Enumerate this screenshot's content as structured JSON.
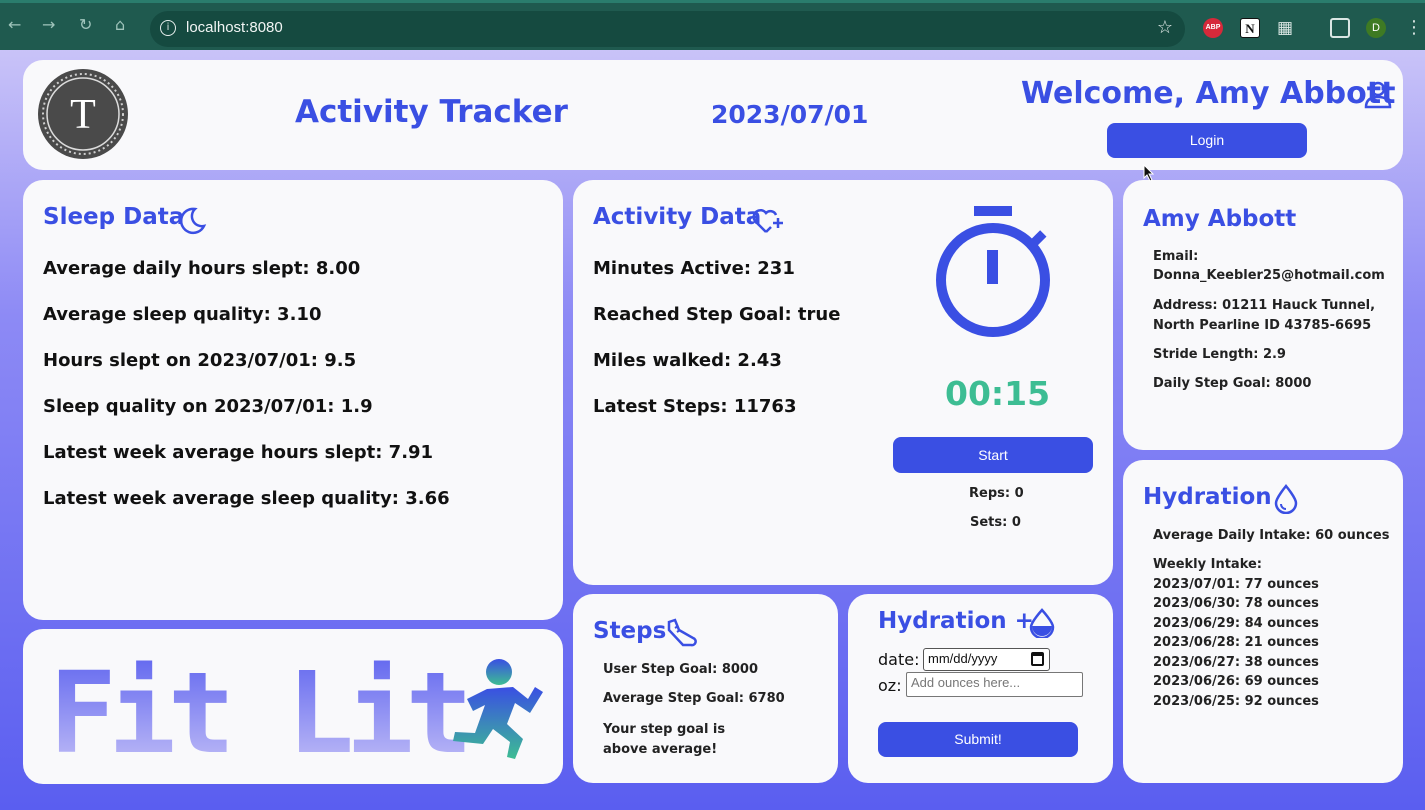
{
  "browser": {
    "url": "localhost:8080",
    "profile_initial": "D",
    "abp_label": "ABP",
    "notion_label": "N"
  },
  "header": {
    "logo_letter": "T",
    "title": "Activity Tracker",
    "date": "2023/07/01",
    "welcome": "Welcome, Amy Abbott",
    "login_label": "Login"
  },
  "sleep": {
    "title": "Sleep Data",
    "rows": [
      "Average daily hours slept: 8.00",
      "Average sleep quality: 3.10",
      "Hours slept on 2023/07/01: 9.5",
      "Sleep quality on 2023/07/01: 1.9",
      "Latest week average hours slept: 7.91",
      "Latest week average sleep quality: 3.66"
    ]
  },
  "activity": {
    "title": "Activity Data",
    "rows": [
      "Minutes Active: 231",
      "Reached Step Goal: true",
      "Miles walked: 2.43",
      "Latest Steps: 11763"
    ],
    "timer": "00:15",
    "start_label": "Start",
    "reps": "Reps: 0",
    "sets": "Sets: 0"
  },
  "profile": {
    "name": "Amy Abbott",
    "email_label": "Email:",
    "email": "Donna_Keebler25@hotmail.com",
    "address": "Address: 01211 Hauck Tunnel, North Pearline ID 43785-6695",
    "stride": "Stride Length: 2.9",
    "step_goal": "Daily Step Goal: 8000"
  },
  "hydration": {
    "title": "Hydration",
    "average": "Average Daily Intake: 60 ounces",
    "weekly_label": "Weekly Intake:",
    "weekly": [
      "2023/07/01: 77 ounces",
      "2023/06/30: 78 ounces",
      "2023/06/29: 84 ounces",
      "2023/06/28: 21 ounces",
      "2023/06/27: 38 ounces",
      "2023/06/26: 69 ounces",
      "2023/06/25: 92 ounces"
    ]
  },
  "fitlit": {
    "wordmark": "Fit Lit"
  },
  "steps": {
    "title": "Steps",
    "user_goal": "User Step Goal: 8000",
    "avg_goal": "Average Step Goal: 6780",
    "message": "Your step goal is above average!"
  },
  "hydration_form": {
    "title": "Hydration +",
    "date_label": "date:",
    "date_placeholder": "mm/dd/yyyy",
    "oz_label": "oz:",
    "oz_placeholder": "Add ounces here...",
    "submit_label": "Submit!"
  },
  "colors": {
    "accent": "#3a4fe3",
    "timer": "#3dbd93",
    "card": "#f9f9fb"
  }
}
